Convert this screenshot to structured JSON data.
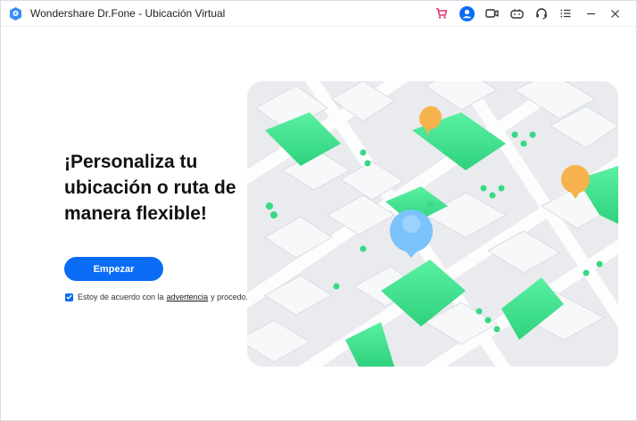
{
  "window": {
    "title": "Wondershare Dr.Fone - Ubicación Virtual"
  },
  "titlebar_icons": [
    "shopping-cart-icon",
    "account-icon",
    "video-camera-icon",
    "gamepad-icon",
    "headset-icon",
    "list-icon",
    "minimize-icon",
    "close-icon"
  ],
  "main": {
    "headline_lines": [
      "¡Personaliza tu",
      "ubicación o ruta de",
      "manera flexible!"
    ],
    "start_button": "Empezar",
    "agreement": {
      "prefix": "Estoy de acuerdo con la",
      "link": "advertencia",
      "suffix": "y procedo.",
      "checked": true
    }
  },
  "colors": {
    "primary": "#0a6cf5",
    "map_green": "#3be28c",
    "pin_blue": "#7cc2fb",
    "pin_orange": "#f6b24c"
  }
}
